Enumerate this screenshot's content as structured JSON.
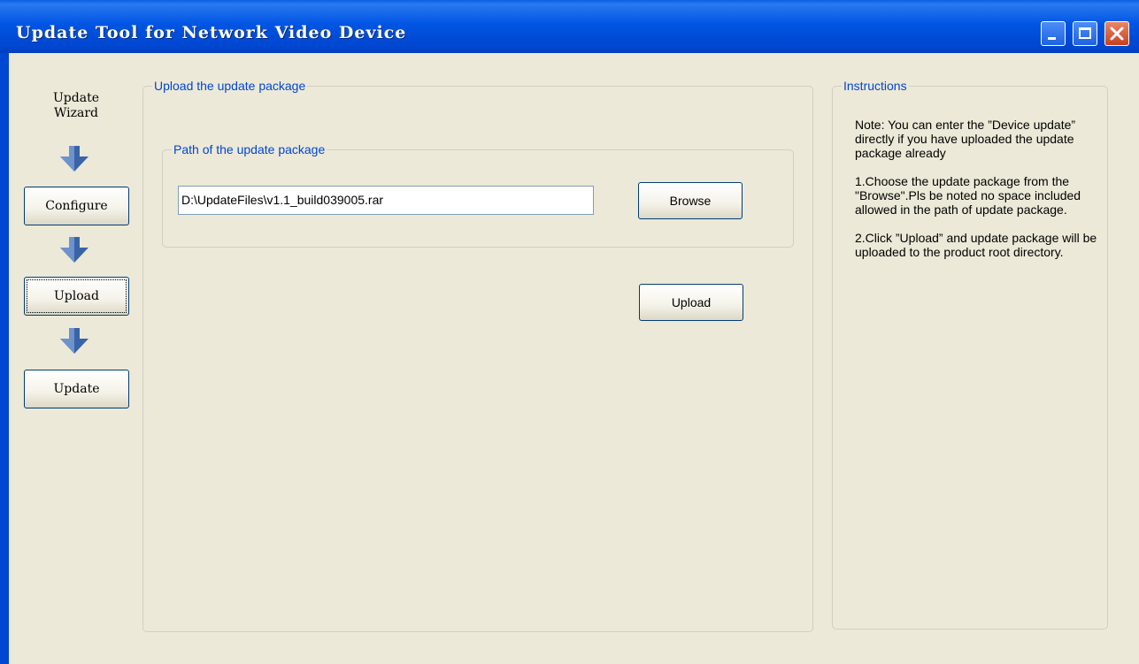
{
  "window": {
    "title": "Update Tool for Network Video Device"
  },
  "wizard": {
    "label": "Update\nWizard",
    "steps": [
      {
        "label": "Configure"
      },
      {
        "label": "Upload"
      },
      {
        "label": "Update"
      }
    ],
    "active_step": "Upload"
  },
  "upload_group": {
    "title": "Upload the update package",
    "path_group": {
      "title": "Path of the update package",
      "path_value": "D:\\UpdateFiles\\v1.1_build039005.rar",
      "browse_label": "Browse"
    },
    "upload_label": "Upload"
  },
  "instructions": {
    "title": "Instructions",
    "paragraphs": [
      "Note: You can enter the ”Device update” directly if you have uploaded the update package already",
      "1.Choose the update package from the \"Browse\".Pls be noted no space included allowed in the path of update package.",
      "2.Click ”Upload” and update package will be uploaded to the product root directory."
    ]
  },
  "colors": {
    "titlebar": "#0055E3",
    "face": "#ECE9D8",
    "group_title": "#0046D5",
    "arrow": "#3A64A8"
  },
  "icons": {
    "minimize": "minimize-icon",
    "maximize": "maximize-icon",
    "close": "close-icon",
    "step_arrow": "arrow-down-icon"
  }
}
